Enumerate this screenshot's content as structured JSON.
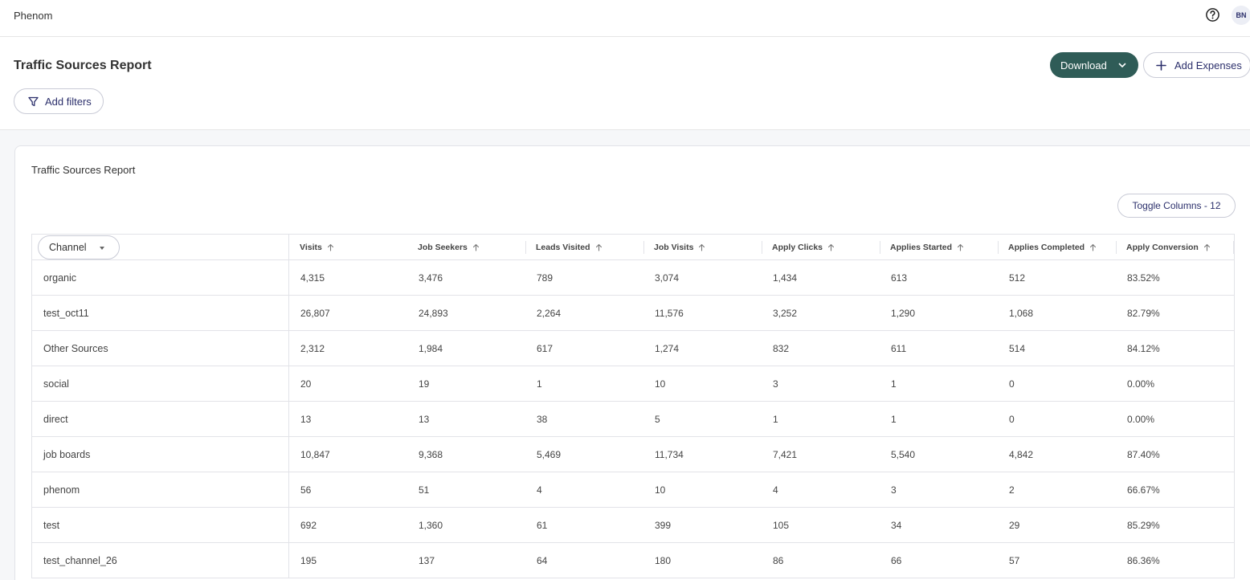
{
  "app": {
    "brand": "Phenom",
    "user_initials": "BN"
  },
  "header": {
    "title": "Traffic Sources Report",
    "download_label": "Download",
    "add_expenses_label": "Add Expenses",
    "add_filters_label": "Add filters"
  },
  "card": {
    "title": "Traffic Sources Report",
    "toggle_columns_label": "Toggle Columns - 12"
  },
  "table": {
    "channel_header": "Channel",
    "columns": [
      "Visits",
      "Job Seekers",
      "Leads Visited",
      "Job Visits",
      "Apply Clicks",
      "Applies Started",
      "Applies Completed",
      "Apply Conversion"
    ],
    "rows": [
      [
        "organic",
        "4,315",
        "3,476",
        "789",
        "3,074",
        "1,434",
        "613",
        "512",
        "83.52%"
      ],
      [
        "test_oct11",
        "26,807",
        "24,893",
        "2,264",
        "11,576",
        "3,252",
        "1,290",
        "1,068",
        "82.79%"
      ],
      [
        "Other Sources",
        "2,312",
        "1,984",
        "617",
        "1,274",
        "832",
        "611",
        "514",
        "84.12%"
      ],
      [
        "social",
        "20",
        "19",
        "1",
        "10",
        "3",
        "1",
        "0",
        "0.00%"
      ],
      [
        "direct",
        "13",
        "13",
        "38",
        "5",
        "1",
        "1",
        "0",
        "0.00%"
      ],
      [
        "job boards",
        "10,847",
        "9,368",
        "5,469",
        "11,734",
        "7,421",
        "5,540",
        "4,842",
        "87.40%"
      ],
      [
        "phenom",
        "56",
        "51",
        "4",
        "10",
        "4",
        "3",
        "2",
        "66.67%"
      ],
      [
        "test",
        "692",
        "1,360",
        "61",
        "399",
        "105",
        "34",
        "29",
        "85.29%"
      ],
      [
        "test_channel_26",
        "195",
        "137",
        "64",
        "180",
        "86",
        "66",
        "57",
        "86.36%"
      ]
    ]
  },
  "icons": {
    "help": "help-circle-icon",
    "download_chevron": "chevron-down-icon",
    "add": "plus-icon",
    "filter": "funnel-icon",
    "sort": "sort-arrow-up-icon",
    "channel_caret": "caret-down-icon"
  },
  "colors": {
    "primary": "#2f5c57",
    "link": "#2b2f6b",
    "border": "#e2e3e8"
  }
}
